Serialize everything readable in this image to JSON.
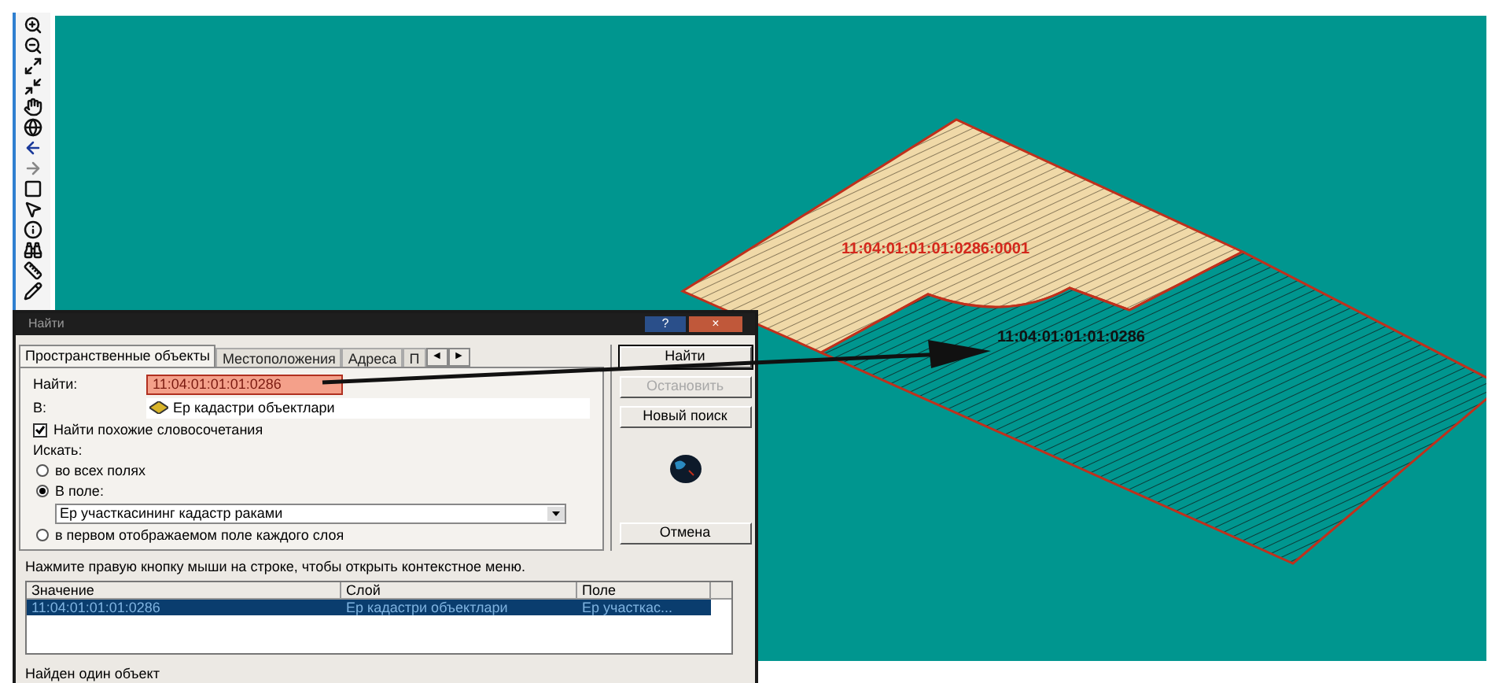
{
  "map": {
    "labels": [
      {
        "text": "11:04:01:01:01:0286:0001",
        "kind": "part"
      },
      {
        "text": "11:04:01:01:01:0286",
        "kind": "parent"
      }
    ]
  },
  "dialog": {
    "title": "Найти",
    "title_buttons": [
      "?",
      "×"
    ],
    "tabs": [
      {
        "label": "Пространственные объекты",
        "selected": true
      },
      {
        "label": "Местоположения",
        "selected": false
      },
      {
        "label": "Адреса",
        "selected": false
      },
      {
        "label": "П",
        "selected": false
      }
    ],
    "tab_scroll": [
      "◄",
      "►"
    ],
    "find_label": "Найти:",
    "find_value": "11:04:01:01:01:0286",
    "in_label": "В:",
    "layer": "Ер кадастри объектлари",
    "similar": {
      "label": "Найти похожие словосочетания",
      "checked": true
    },
    "search_label": "Искать:",
    "options": [
      {
        "label": "во всех полях",
        "selected": false
      },
      {
        "label": "В поле:",
        "selected": true,
        "field": "Ер участкасининг кадастр раками"
      },
      {
        "label": "в первом отображаемом поле каждого слоя",
        "selected": false
      }
    ],
    "buttons": [
      {
        "label": "Найти",
        "disabled": false
      },
      {
        "label": "Остановить",
        "disabled": true
      },
      {
        "label": "Новый поиск",
        "disabled": false
      },
      {
        "label": "Отмена",
        "disabled": false
      }
    ],
    "hint": "Нажмите правую кнопку мыши на строке, чтобы открыть контекстное меню.",
    "table": {
      "columns": [
        "Значение",
        "Слой",
        "Поле"
      ],
      "rows": [
        {
          "cells": [
            "11:04:01:01:01:0286",
            "Ер кадастри объектлари",
            "Ер участкас..."
          ],
          "selected": true
        }
      ]
    },
    "status": "Найден один объект"
  }
}
